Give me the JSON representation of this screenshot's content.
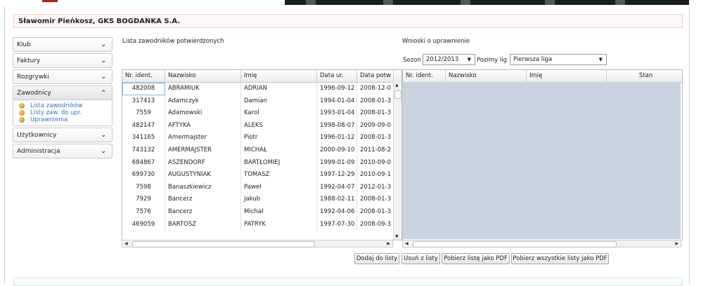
{
  "user_bar": {
    "title": "Sławomir Pieńkosz, GKS BOGDANKA S.A."
  },
  "sidebar": {
    "items": [
      {
        "label": "Klub",
        "chevron": "chevron-down-icon"
      },
      {
        "label": "Faktury",
        "chevron": "chevron-down-icon"
      },
      {
        "label": "Rozgrywki",
        "chevron": "chevron-down-icon"
      },
      {
        "label": "Zawodnicy",
        "chevron": "chevron-up-icon"
      },
      {
        "label": "Użytkownicy",
        "chevron": "chevron-down-icon"
      },
      {
        "label": "Administracja",
        "chevron": "chevron-down-icon"
      }
    ],
    "submenu": [
      {
        "label": "Lista zawodników",
        "icon": "coins-icon"
      },
      {
        "label": "Listy zaw. do upr.",
        "icon": "coins-icon"
      },
      {
        "label": "Uprawnienia",
        "icon": "coins-icon"
      }
    ]
  },
  "left_panel": {
    "title": "Lista zawodników potwierdzonych",
    "columns": [
      "Nr. ident.",
      "Nazwisko",
      "Imię",
      "Data ur.",
      "Data potw"
    ],
    "rows": [
      [
        "482008",
        "ABRAMIUK",
        "ADRIAN",
        "1996-09-12",
        "2008-12-0"
      ],
      [
        "317413",
        "Adamczyk",
        "Damian",
        "1994-01-04",
        "2008-01-3"
      ],
      [
        "7559",
        "Adamowski",
        "Karol",
        "1993-01-04",
        "2008-01-3"
      ],
      [
        "482147",
        "AFTYKA",
        "ALEKS",
        "1998-08-07",
        "2009-09-0"
      ],
      [
        "341165",
        "Amermajster",
        "Piotr",
        "1996-01-12",
        "2008-01-3"
      ],
      [
        "743132",
        "AMERMAJSTER",
        "MICHAŁ",
        "2000-09-10",
        "2011-08-2"
      ],
      [
        "684867",
        "ASZENDORF",
        "BARTŁOMIEJ",
        "1999-01-09",
        "2010-09-0"
      ],
      [
        "699730",
        "AUGUSTYNIAK",
        "TOMASZ",
        "1997-12-29",
        "2010-09-1"
      ],
      [
        "7598",
        "Banaszkiewicz",
        "Paweł",
        "1992-04-07",
        "2012-01-3"
      ],
      [
        "7929",
        "Bancerz",
        "Jakub",
        "1988-02-11",
        "2008-01-3"
      ],
      [
        "7576",
        "Bancerz",
        "Michał",
        "1992-04-06",
        "2008-01-3"
      ],
      [
        "469059",
        "BARTOSZ",
        "PATRYK",
        "1997-07-30",
        "2008-09-3"
      ]
    ]
  },
  "right_panel": {
    "title": "Wnioski o uprawnienie",
    "season_label": "Sezon",
    "season_value": "2012/2013",
    "level_label": "Pozimy lig",
    "level_value": "Pierwsza liga",
    "columns": [
      "Nr. ident.",
      "Nazwisko",
      "Imię",
      "Stan"
    ]
  },
  "buttons": {
    "add": "Dodaj do listy",
    "remove": "Usuń z listy",
    "pdf_one": "Pobierz listę jako PDF",
    "pdf_all": "Pobierz wszystkie listy jako PDF"
  },
  "colors": {
    "accent_link": "#3a6fc6",
    "grid_empty": "#c7d3df",
    "user_bar_border": "#f0c8c8"
  }
}
